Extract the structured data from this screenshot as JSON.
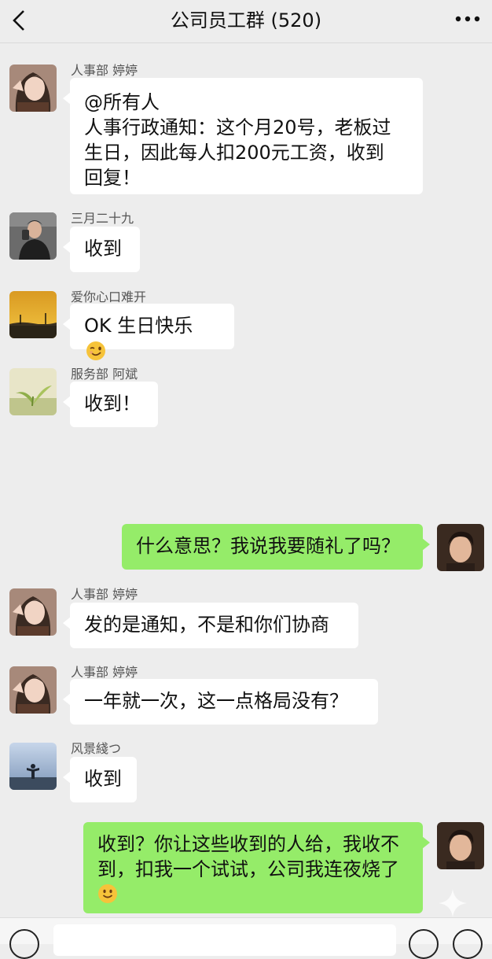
{
  "header": {
    "title": "公司员工群 (520)"
  },
  "messages": [
    {
      "sender": "人事部 婷婷",
      "side": "left",
      "avatar_icon": "girl-selfie-avatar",
      "lines": [
        "@所有人",
        "人事行政通知：这个月20号，老板过",
        "生日，因此每人扣200元工资，收到",
        "回复！"
      ]
    },
    {
      "sender": "三月二十九",
      "side": "left",
      "avatar_icon": "man-mirror-selfie-avatar",
      "text": "收到"
    },
    {
      "sender": "爱你心口难开",
      "side": "left",
      "avatar_icon": "sunset-avatar",
      "text": "OK 生日快乐",
      "emoji": "wink-emoji"
    },
    {
      "sender": "服务部 阿斌",
      "side": "left",
      "avatar_icon": "plant-sprout-avatar",
      "text": "收到！"
    },
    {
      "side": "right",
      "avatar_icon": "young-man-avatar",
      "text": "什么意思？我说我要随礼了吗？"
    },
    {
      "sender": "人事部 婷婷",
      "side": "left",
      "avatar_icon": "girl-selfie-avatar",
      "text": "发的是通知，不是和你们协商"
    },
    {
      "sender": "人事部 婷婷",
      "side": "left",
      "avatar_icon": "girl-selfie-avatar",
      "text": "一年就一次，这一点格局没有？"
    },
    {
      "sender": "风景綫つ",
      "side": "left",
      "avatar_icon": "landscape-person-avatar",
      "text": "收到"
    },
    {
      "side": "right",
      "avatar_icon": "young-man-avatar",
      "lines": [
        "收到？你让这些收到的人给，我收不",
        "到，扣我一个试试，公司我连夜烧了"
      ],
      "emoji": "smile-emoji"
    }
  ],
  "colors": {
    "background": "#ededed",
    "outgoing_bubble": "#95ec69",
    "incoming_bubble": "#ffffff"
  }
}
